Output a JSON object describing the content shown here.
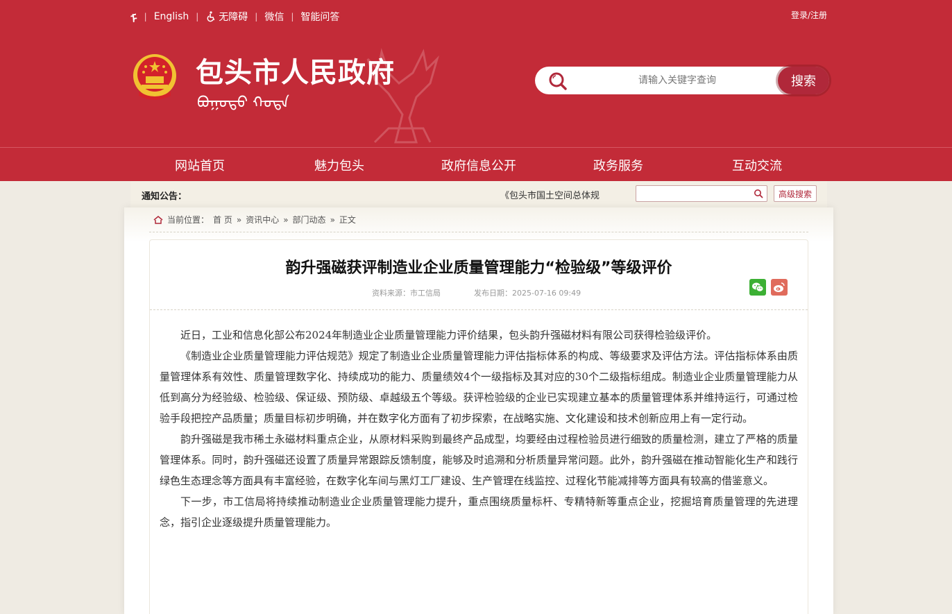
{
  "topbar": {
    "mongol_icon": "ᠮ",
    "english": "English",
    "accessibility": "无障碍",
    "wechat": "微信",
    "qa": "智能问答",
    "login": "登录/注册"
  },
  "header": {
    "site_title": "包头市人民政府",
    "mongol_text": "ᠪᠣᠭᠣᠲᠣ ᠬᠣᠲᠠ",
    "search_placeholder": "请输入关键字查询",
    "search_button": "搜索"
  },
  "nav": {
    "items": [
      "网站首页",
      "魅力包头",
      "政府信息公开",
      "政务服务",
      "互动交流"
    ]
  },
  "notice": {
    "label": "通知公告：",
    "scroll_text": "《包头市国土空间总体规",
    "advanced_search": "高级搜索"
  },
  "breadcrumb": {
    "prefix": "当前位置：",
    "items": [
      "首 页",
      "资讯中心",
      "部门动态",
      "正文"
    ],
    "separator": "»"
  },
  "article": {
    "title": "韵升强磁获评制造业企业质量管理能力“检验级”等级评价",
    "source": "资料来源：市工信局",
    "date": "发布日期：2025-07-16 09:49",
    "paragraphs": [
      "近日，工业和信息化部公布2024年制造业企业质量管理能力评价结果，包头韵升强磁材料有限公司获得检验级评价。",
      "《制造业企业质量管理能力评估规范》规定了制造业企业质量管理能力评估指标体系的构成、等级要求及评估方法。评估指标体系由质量管理体系有效性、质量管理数字化、持续成功的能力、质量绩效4个一级指标及其对应的30个二级指标组成。制造业企业质量管理能力从低到高分为经验级、检验级、保证级、预防级、卓越级五个等级。获评检验级的企业已实现建立基本的质量管理体系并维持运行，可通过检验手段把控产品质量；质量目标初步明确，并在数字化方面有了初步探索，在战略实施、文化建设和技术创新应用上有一定行动。",
      "韵升强磁是我市稀土永磁材料重点企业，从原材料采购到最终产品成型，均要经由过程检验员进行细致的质量检测，建立了严格的质量管理体系。同时，韵升强磁还设置了质量异常跟踪反馈制度，能够及时追溯和分析质量异常问题。此外，韵升强磁在推动智能化生产和践行绿色生态理念等方面具有丰富经验，在数字化车间与黑灯工厂建设、生产管理在线监控、过程化节能减排等方面具有较高的借鉴意义。",
      "下一步，市工信局将持续推动制造业企业质量管理能力提升，重点围绕质量标杆、专精特新等重点企业，挖掘培育质量管理的先进理念，指引企业逐级提升质量管理能力。"
    ]
  },
  "colors": {
    "brand_red": "#c32b38",
    "page_bg": "#efebe3"
  }
}
